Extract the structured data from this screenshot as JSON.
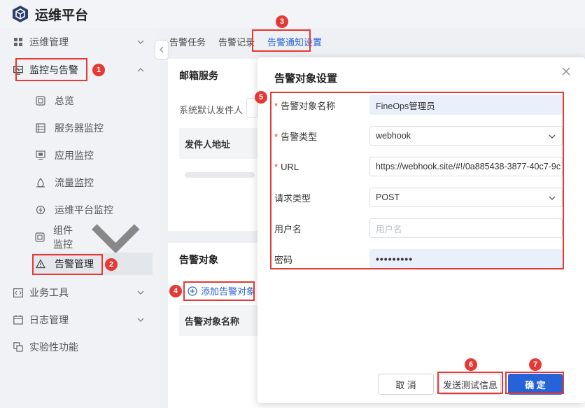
{
  "app": {
    "title": "运维平台"
  },
  "sidebar": {
    "items": [
      {
        "label": "运维管理"
      },
      {
        "label": "监控与告警"
      },
      {
        "label": "业务工具"
      },
      {
        "label": "日志管理"
      },
      {
        "label": "实验性功能"
      }
    ],
    "monitor_children": [
      {
        "label": "总览"
      },
      {
        "label": "服务器监控"
      },
      {
        "label": "应用监控"
      },
      {
        "label": "流量监控"
      },
      {
        "label": "运维平台监控"
      },
      {
        "label": "组件监控"
      },
      {
        "label": "告警管理"
      }
    ]
  },
  "tabs": [
    {
      "label": "告警任务"
    },
    {
      "label": "告警记录"
    },
    {
      "label": "告警通知设置"
    }
  ],
  "mail_card": {
    "title": "邮箱服务",
    "default_sender_label": "系统默认发件人",
    "column_sender": "发件人地址"
  },
  "target_card": {
    "title": "告警对象",
    "add_label": "添加告警对象",
    "column_name": "告警对象名称"
  },
  "modal": {
    "title": "告警对象设置",
    "fields": {
      "name": {
        "label": "告警对象名称",
        "value": "FineOps管理员"
      },
      "type": {
        "label": "告警类型",
        "value": "webhook"
      },
      "url": {
        "label": "URL",
        "value": "https://webhook.site/#!/0a885438-3877-40c7-9c"
      },
      "request_type": {
        "label": "请求类型",
        "value": "POST"
      },
      "username": {
        "label": "用户名",
        "placeholder": "用户名"
      },
      "password": {
        "label": "密码",
        "value": "•••••••••"
      }
    },
    "buttons": {
      "cancel": "取 消",
      "test": "发送测试信息",
      "ok": "确 定"
    }
  },
  "annotations": [
    "1",
    "2",
    "3",
    "4",
    "5",
    "6",
    "7"
  ],
  "colors": {
    "accent": "#2763d8",
    "annotation": "#e53935"
  }
}
